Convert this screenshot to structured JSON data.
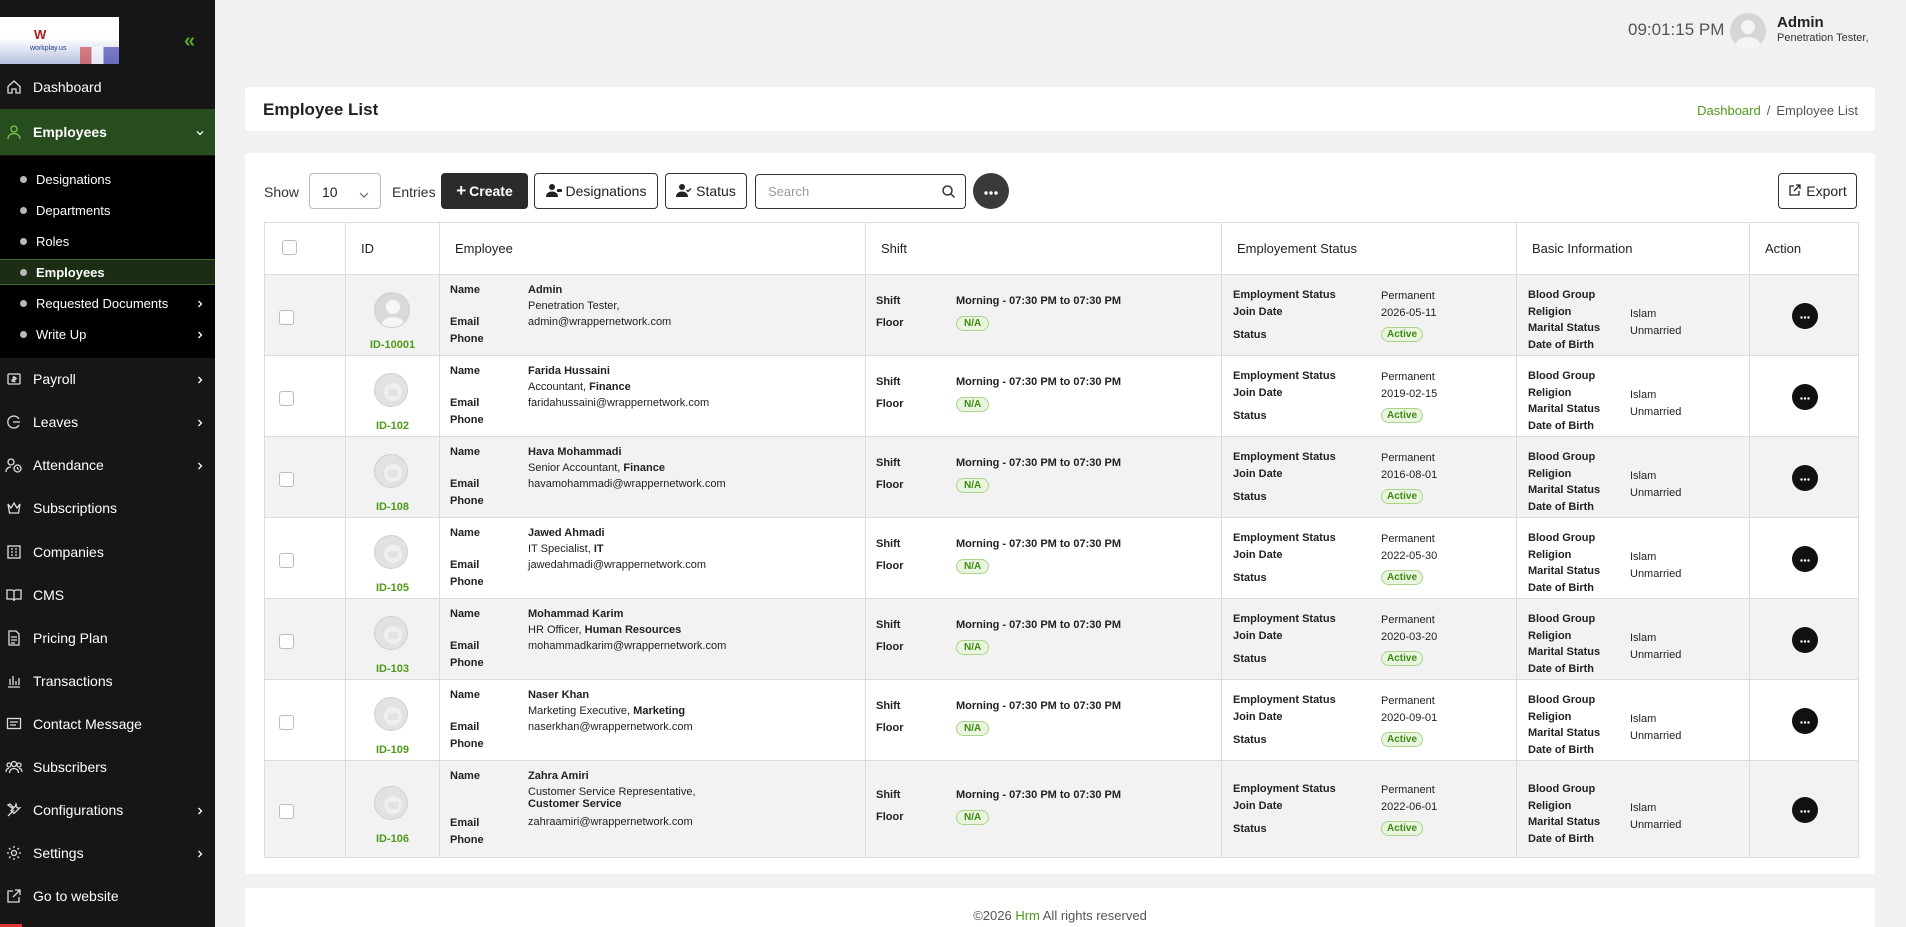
{
  "app": {
    "logo_text": "workplay.us"
  },
  "sidebar": {
    "items": [
      {
        "label": "Dashboard",
        "icon": "home-icon"
      },
      {
        "label": "Employees",
        "icon": "user-icon"
      },
      {
        "label": "Payroll",
        "icon": "payroll-icon"
      },
      {
        "label": "Leaves",
        "icon": "leave-icon"
      },
      {
        "label": "Attendance",
        "icon": "attendance-icon"
      },
      {
        "label": "Subscriptions",
        "icon": "crown-icon"
      },
      {
        "label": "Companies",
        "icon": "building-icon"
      },
      {
        "label": "CMS",
        "icon": "book-icon"
      },
      {
        "label": "Pricing Plan",
        "icon": "document-icon"
      },
      {
        "label": "Transactions",
        "icon": "chart-icon"
      },
      {
        "label": "Contact Message",
        "icon": "message-icon"
      },
      {
        "label": "Subscribers",
        "icon": "users-icon"
      },
      {
        "label": "Configurations",
        "icon": "tools-icon"
      },
      {
        "label": "Settings",
        "icon": "gear-icon"
      },
      {
        "label": "Go to website",
        "icon": "external-link-icon"
      }
    ],
    "sub_items": [
      {
        "label": "Designations"
      },
      {
        "label": "Departments"
      },
      {
        "label": "Roles"
      },
      {
        "label": "Employees"
      },
      {
        "label": "Requested Documents"
      },
      {
        "label": "Write Up"
      }
    ]
  },
  "topbar": {
    "time": "09:01:15 PM",
    "user_name": "Admin",
    "user_role": "Penetration Tester,"
  },
  "page": {
    "title": "Employee List",
    "breadcrumb": {
      "home": "Dashboard",
      "separator": "/",
      "current": "Employee List"
    }
  },
  "toolbar": {
    "show_label": "Show",
    "page_size": "10",
    "entries_label": "Entries",
    "create_label": "Create",
    "designations_label": "Designations",
    "status_label": "Status",
    "search_placeholder": "Search",
    "export_label": "Export"
  },
  "table": {
    "columns": [
      "ID",
      "Employee",
      "Shift",
      "Employement Status",
      "Basic Information",
      "Action"
    ],
    "labels": {
      "name": "Name",
      "email": "Email",
      "phone": "Phone",
      "shift": "Shift",
      "floor": "Floor",
      "employment_status": "Employment Status",
      "join_date": "Join Date",
      "status": "Status",
      "blood_group": "Blood Group",
      "religion": "Religion",
      "marital_status": "Marital Status",
      "dob": "Date of Birth"
    },
    "rows": [
      {
        "id": "ID-10001",
        "name": "Admin",
        "title": "Penetration Tester,",
        "dept": "",
        "email": "admin@wrappernetwork.com",
        "shift": "Morning - 07:30 PM to 07:30 PM",
        "floor": "N/A",
        "employment": "Permanent",
        "join": "2026-05-11",
        "status": "Active",
        "religion": "Islam",
        "marital": "Unmarried"
      },
      {
        "id": "ID-102",
        "name": "Farida Hussaini",
        "title": "Accountant,",
        "dept": "Finance",
        "email": "faridahussaini@wrappernetwork.com",
        "shift": "Morning - 07:30 PM to 07:30 PM",
        "floor": "N/A",
        "employment": "Permanent",
        "join": "2019-02-15",
        "status": "Active",
        "religion": "Islam",
        "marital": "Unmarried"
      },
      {
        "id": "ID-108",
        "name": "Hava Mohammadi",
        "title": "Senior Accountant,",
        "dept": "Finance",
        "email": "havamohammadi@wrappernetwork.com",
        "shift": "Morning - 07:30 PM to 07:30 PM",
        "floor": "N/A",
        "employment": "Permanent",
        "join": "2016-08-01",
        "status": "Active",
        "religion": "Islam",
        "marital": "Unmarried"
      },
      {
        "id": "ID-105",
        "name": "Jawed Ahmadi",
        "title": "IT Specialist,",
        "dept": "IT",
        "email": "jawedahmadi@wrappernetwork.com",
        "shift": "Morning - 07:30 PM to 07:30 PM",
        "floor": "N/A",
        "employment": "Permanent",
        "join": "2022-05-30",
        "status": "Active",
        "religion": "Islam",
        "marital": "Unmarried"
      },
      {
        "id": "ID-103",
        "name": "Mohammad Karim",
        "title": "HR Officer,",
        "dept": "Human Resources",
        "email": "mohammadkarim@wrappernetwork.com",
        "shift": "Morning - 07:30 PM to 07:30 PM",
        "floor": "N/A",
        "employment": "Permanent",
        "join": "2020-03-20",
        "status": "Active",
        "religion": "Islam",
        "marital": "Unmarried"
      },
      {
        "id": "ID-109",
        "name": "Naser Khan",
        "title": "Marketing Executive,",
        "dept": "Marketing",
        "email": "naserkhan@wrappernetwork.com",
        "shift": "Morning - 07:30 PM to 07:30 PM",
        "floor": "N/A",
        "employment": "Permanent",
        "join": "2020-09-01",
        "status": "Active",
        "religion": "Islam",
        "marital": "Unmarried"
      },
      {
        "id": "ID-106",
        "name": "Zahra Amiri",
        "title": "Customer Service Representative,",
        "dept": "Customer Service",
        "email": "zahraamiri@wrappernetwork.com",
        "shift": "Morning - 07:30 PM to 07:30 PM",
        "floor": "N/A",
        "employment": "Permanent",
        "join": "2022-06-01",
        "status": "Active",
        "religion": "Islam",
        "marital": "Unmarried"
      }
    ]
  },
  "footer": {
    "year": "©2026",
    "brand": "Hrm",
    "rights": "All rights reserved"
  },
  "colors": {
    "accent": "#4f9a1a",
    "sidebar_bg": "#161616",
    "sidebar_active": "#274d1f",
    "dark_button": "#2b2b2b"
  }
}
